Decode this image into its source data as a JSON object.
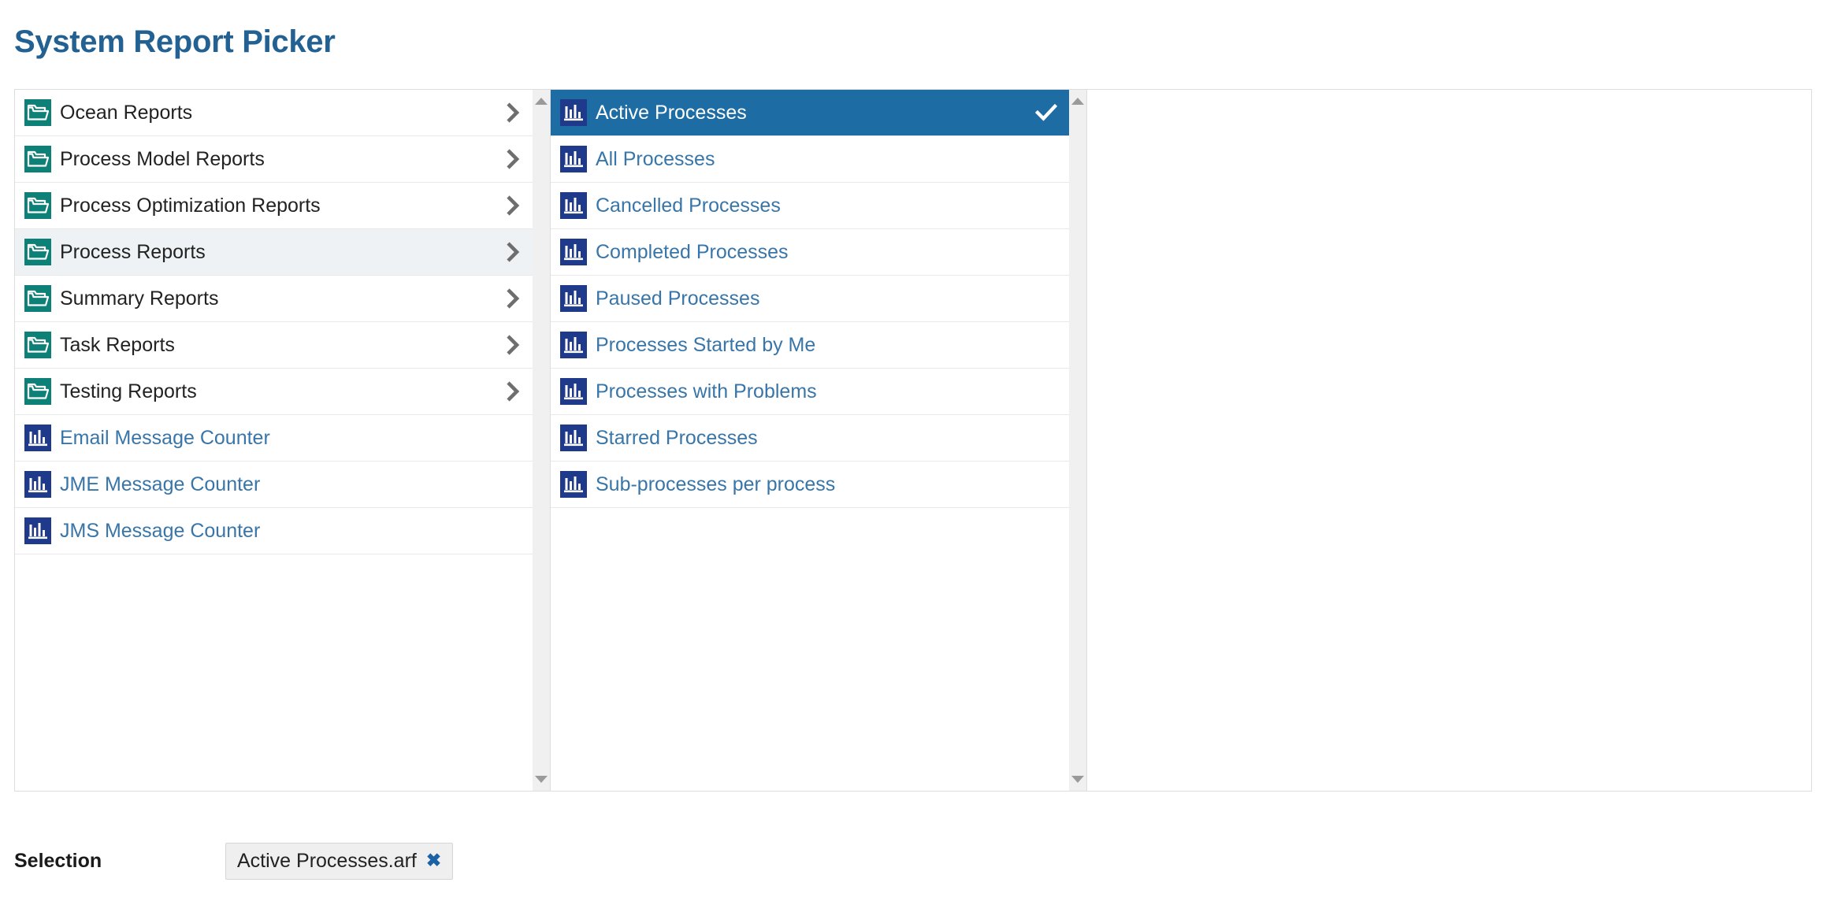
{
  "page": {
    "title": "System Report Picker"
  },
  "colors": {
    "title": "#236192",
    "folder_icon_bg": "#0d8077",
    "report_icon_bg": "#1f3a8a",
    "selected_row_bg": "#1d6ca3",
    "highlight_row_bg": "#eef2f5",
    "link_text": "#3875a8",
    "chip_remove": "#1b61a5"
  },
  "columns": [
    {
      "name": "first-column",
      "scrollbar": {
        "up_arrow": "triangle-up-icon",
        "down_arrow": "triangle-down-icon"
      },
      "items": [
        {
          "label": "Ocean Reports",
          "icon": "folder-icon",
          "type": "folder",
          "expandable": true,
          "state": "normal"
        },
        {
          "label": "Process Model Reports",
          "icon": "folder-icon",
          "type": "folder",
          "expandable": true,
          "state": "normal"
        },
        {
          "label": "Process Optimization Reports",
          "icon": "folder-icon",
          "type": "folder",
          "expandable": true,
          "state": "normal"
        },
        {
          "label": "Process Reports",
          "icon": "folder-icon",
          "type": "folder",
          "expandable": true,
          "state": "highlighted"
        },
        {
          "label": "Summary Reports",
          "icon": "folder-icon",
          "type": "folder",
          "expandable": true,
          "state": "normal"
        },
        {
          "label": "Task Reports",
          "icon": "folder-icon",
          "type": "folder",
          "expandable": true,
          "state": "normal"
        },
        {
          "label": "Testing Reports",
          "icon": "folder-icon",
          "type": "folder",
          "expandable": true,
          "state": "normal"
        },
        {
          "label": "Email Message Counter",
          "icon": "report-icon",
          "type": "report",
          "expandable": false,
          "state": "normal"
        },
        {
          "label": "JME Message Counter",
          "icon": "report-icon",
          "type": "report",
          "expandable": false,
          "state": "normal"
        },
        {
          "label": "JMS Message Counter",
          "icon": "report-icon",
          "type": "report",
          "expandable": false,
          "state": "normal"
        }
      ]
    },
    {
      "name": "second-column",
      "scrollbar": {
        "up_arrow": "triangle-up-icon",
        "down_arrow": "triangle-down-icon"
      },
      "items": [
        {
          "label": "Active Processes",
          "icon": "report-icon",
          "type": "report",
          "expandable": false,
          "state": "selected"
        },
        {
          "label": "All Processes",
          "icon": "report-icon",
          "type": "report",
          "expandable": false,
          "state": "normal"
        },
        {
          "label": "Cancelled Processes",
          "icon": "report-icon",
          "type": "report",
          "expandable": false,
          "state": "normal"
        },
        {
          "label": "Completed Processes",
          "icon": "report-icon",
          "type": "report",
          "expandable": false,
          "state": "normal"
        },
        {
          "label": "Paused Processes",
          "icon": "report-icon",
          "type": "report",
          "expandable": false,
          "state": "normal"
        },
        {
          "label": "Processes Started by Me",
          "icon": "report-icon",
          "type": "report",
          "expandable": false,
          "state": "normal"
        },
        {
          "label": "Processes with Problems",
          "icon": "report-icon",
          "type": "report",
          "expandable": false,
          "state": "normal"
        },
        {
          "label": "Starred Processes",
          "icon": "report-icon",
          "type": "report",
          "expandable": false,
          "state": "normal"
        },
        {
          "label": "Sub-processes per process",
          "icon": "report-icon",
          "type": "report",
          "expandable": false,
          "state": "normal"
        }
      ]
    },
    {
      "name": "third-column",
      "items": []
    }
  ],
  "selection": {
    "label": "Selection",
    "chips": [
      {
        "label": "Active Processes.arf",
        "remove_icon": "close-x-icon"
      }
    ]
  }
}
